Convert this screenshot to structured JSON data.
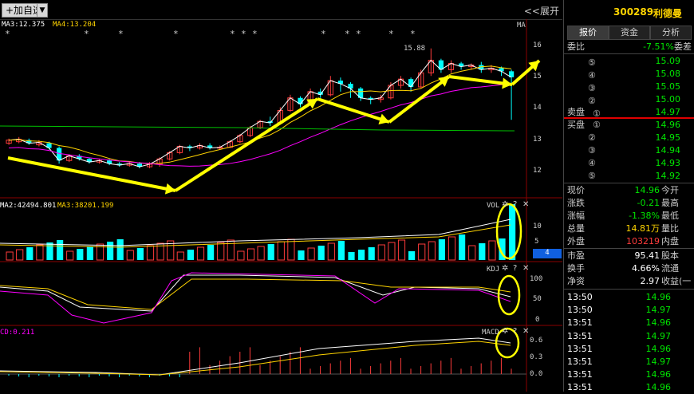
{
  "toolbar": {
    "add_fav_label": "+加自选",
    "dropdown_glyph": "▼",
    "expand_label": "<<展开"
  },
  "main_chart": {
    "ma_legend": [
      {
        "text": "MA3:12.375",
        "color": "#ffffff"
      },
      {
        "text": "MA4:13.204",
        "color": "#ffd400"
      }
    ],
    "ma_tag": "MA",
    "price_axis": [
      "16",
      "15",
      "14",
      "13",
      "12"
    ],
    "high_label": "15.88",
    "markers": [
      "*",
      "*",
      "*",
      "*",
      "*",
      "*",
      "*",
      "*",
      "*",
      "*",
      "*",
      "*"
    ]
  },
  "vol_panel": {
    "legend": [
      {
        "text": "MA2:42494.801",
        "color": "#ffffff"
      },
      {
        "text": "MA3:38201.199",
        "color": "#ffd400"
      }
    ],
    "title": "VOL",
    "axis": [
      "10",
      "5"
    ],
    "axis_badge": "4"
  },
  "kdj_panel": {
    "title": "KDJ",
    "axis": [
      "100",
      "50",
      "0"
    ]
  },
  "macd_panel": {
    "legend": "CD:0.211",
    "title": "MACD",
    "axis": [
      "0.6",
      "0.3",
      "0.0"
    ]
  },
  "panel_controls": {
    "gear": "✲",
    "help": "?",
    "close": "✕"
  },
  "quote": {
    "code": "300289",
    "name": "利德曼",
    "tabs": [
      "报价",
      "资金",
      "分析"
    ],
    "wei_bi_label": "委比",
    "wei_bi_value": "-7.51%",
    "wei_cha_label": "委差",
    "sell_label": "卖盘",
    "buy_label": "买盘",
    "asks": [
      {
        "level": "⑤",
        "price": "15.09"
      },
      {
        "level": "④",
        "price": "15.08"
      },
      {
        "level": "③",
        "price": "15.05"
      },
      {
        "level": "②",
        "price": "15.00"
      },
      {
        "level": "①",
        "price": "14.97"
      }
    ],
    "bids": [
      {
        "level": "①",
        "price": "14.96"
      },
      {
        "level": "②",
        "price": "14.95"
      },
      {
        "level": "③",
        "price": "14.94"
      },
      {
        "level": "④",
        "price": "14.93"
      },
      {
        "level": "⑤",
        "price": "14.92"
      }
    ],
    "stats": [
      {
        "label": "现价",
        "value": "14.96",
        "value_color": "#00e600",
        "right": "今开"
      },
      {
        "label": "涨跌",
        "value": "-0.21",
        "value_color": "#00e600",
        "right": "最高"
      },
      {
        "label": "涨幅",
        "value": "-1.38%",
        "value_color": "#00e600",
        "right": "最低"
      },
      {
        "label": "总量",
        "value": "14.81万",
        "value_color": "#ffd400",
        "right": "量比"
      },
      {
        "label": "外盘",
        "value": "103219",
        "value_color": "#ff3b3b",
        "right": "内盘"
      },
      {
        "label": "市盈",
        "value": "95.41",
        "value_color": "#ffffff",
        "right": "股本"
      },
      {
        "label": "换手",
        "value": "4.66%",
        "value_color": "#ffffff",
        "right": "流通"
      },
      {
        "label": "净资",
        "value": "2.97",
        "value_color": "#ffffff",
        "right": "收益(一"
      }
    ],
    "ticks": [
      {
        "time": "13:50",
        "price": "14.96"
      },
      {
        "time": "13:50",
        "price": "14.97"
      },
      {
        "time": "13:51",
        "price": "14.96"
      },
      {
        "time": "13:51",
        "price": "14.97"
      },
      {
        "time": "13:51",
        "price": "14.96"
      },
      {
        "time": "13:51",
        "price": "14.97"
      },
      {
        "time": "13:51",
        "price": "14.96"
      },
      {
        "time": "13:51",
        "price": "14.96"
      }
    ]
  }
}
